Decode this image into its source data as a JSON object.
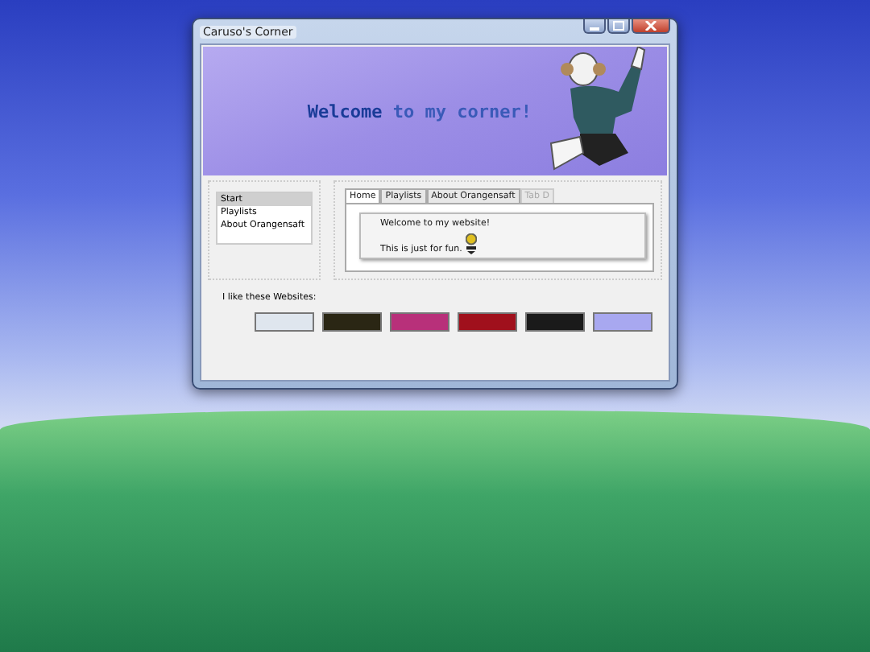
{
  "window": {
    "title": "Caruso's Corner"
  },
  "banner": {
    "heading": "**Welcome** to my corner!"
  },
  "sidebar": {
    "items": [
      {
        "label": "Start",
        "selected": true
      },
      {
        "label": "Playlists",
        "selected": false
      },
      {
        "label": "About Orangensaft",
        "selected": false
      }
    ]
  },
  "tabs": [
    {
      "label": "Home",
      "selected": true,
      "disabled": false
    },
    {
      "label": "Playlists",
      "selected": false,
      "disabled": false
    },
    {
      "label": "About Orangensaft",
      "selected": false,
      "disabled": false
    },
    {
      "label": "Tab D",
      "selected": false,
      "disabled": true
    }
  ],
  "tab_content": {
    "lines": [
      "Welcome to my website!",
      "This is just for fun."
    ]
  },
  "links": {
    "label": "I like these Websites:",
    "badges": [
      {
        "color": "#dfe6ee"
      },
      {
        "color": "#2a2614"
      },
      {
        "color": "#b8307a"
      },
      {
        "color": "#a0101c"
      },
      {
        "color": "#1a1a1a"
      },
      {
        "color": "#a8a8f0"
      }
    ]
  }
}
